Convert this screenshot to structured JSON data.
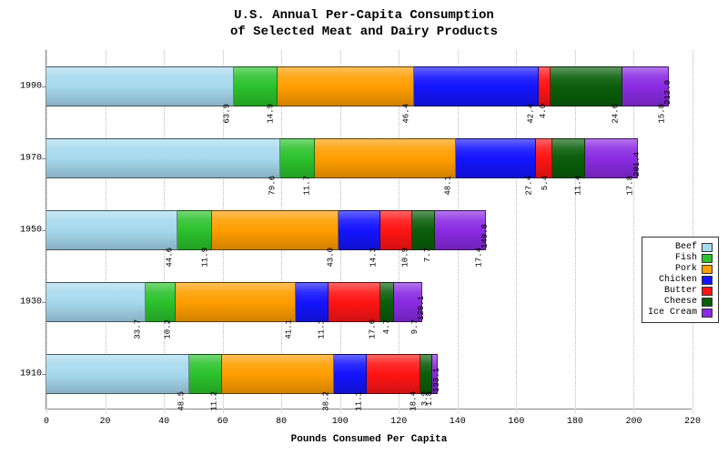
{
  "chart_data": {
    "type": "bar",
    "orientation": "horizontal-stacked",
    "title_line1": "U.S. Annual Per-Capita Consumption",
    "title_line2": "of Selected Meat and Dairy Products",
    "xlabel": "Pounds Consumed Per Capita",
    "ylabel": "",
    "xlim": [
      0,
      220
    ],
    "xticks": [
      0,
      20,
      40,
      60,
      80,
      100,
      120,
      140,
      160,
      180,
      200,
      220
    ],
    "categories": [
      "1990",
      "1970",
      "1950",
      "1930",
      "1910"
    ],
    "series": [
      {
        "name": "Beef",
        "color": "#a6d9ed",
        "values": [
          63.9,
          79.6,
          44.6,
          33.7,
          48.5
        ]
      },
      {
        "name": "Fish",
        "color": "#2cc22c",
        "values": [
          14.9,
          11.7,
          11.9,
          10.2,
          11.2
        ]
      },
      {
        "name": "Pork",
        "color": "#ff9e00",
        "values": [
          46.4,
          48.1,
          43.0,
          41.1,
          38.2
        ]
      },
      {
        "name": "Chicken",
        "color": "#1414ff",
        "values": [
          42.4,
          27.4,
          14.3,
          11.1,
          11.1
        ]
      },
      {
        "name": "Butter",
        "color": "#ff1414",
        "values": [
          4.0,
          5.4,
          10.9,
          17.6,
          18.4
        ]
      },
      {
        "name": "Cheese",
        "color": "#0a5f0a",
        "values": [
          24.6,
          11.4,
          7.7,
          4.7,
          3.9
        ]
      },
      {
        "name": "Ice Cream",
        "color": "#8a2be2",
        "values": [
          15.8,
          17.8,
          17.4,
          9.7,
          1.8
        ]
      }
    ],
    "totals": [
      212.0,
      201.4,
      149.8,
      128.1,
      133.1
    ],
    "legend_position": "right"
  }
}
